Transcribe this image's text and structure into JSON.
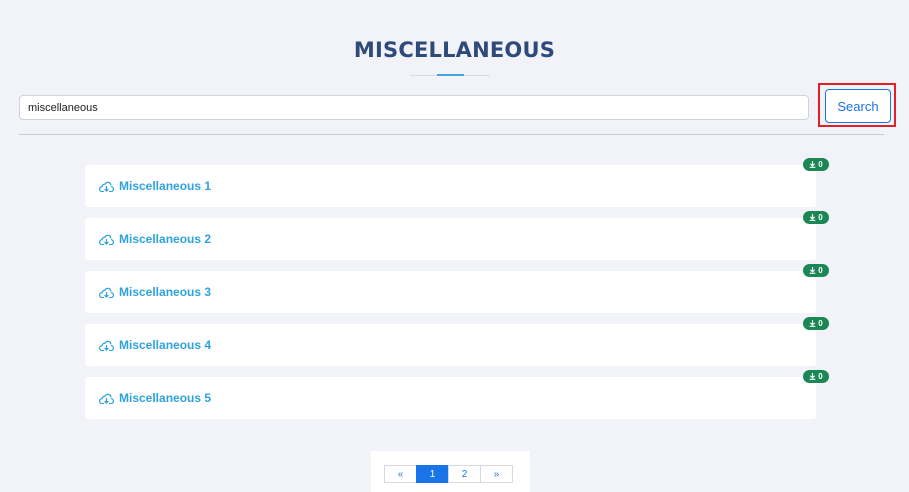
{
  "page": {
    "title": "MISCELLANEOUS"
  },
  "search": {
    "value": "miscellaneous",
    "button_label": "Search"
  },
  "items": [
    {
      "label": "Miscellaneous 1",
      "downloads": "0"
    },
    {
      "label": "Miscellaneous 2",
      "downloads": "0"
    },
    {
      "label": "Miscellaneous 3",
      "downloads": "0"
    },
    {
      "label": "Miscellaneous 4",
      "downloads": "0"
    },
    {
      "label": "Miscellaneous 5",
      "downloads": "0"
    }
  ],
  "pagination": {
    "prev": "«",
    "pages": [
      "1",
      "2"
    ],
    "next": "»",
    "active": "1"
  },
  "icons": {
    "item_icon": "cloud-download-icon",
    "badge_icon": "download-icon"
  },
  "colors": {
    "title": "#2d4a7a",
    "link": "#2ea3dd",
    "badge": "#1a8754",
    "accent": "#1a73e8",
    "highlight": "#e32028"
  }
}
